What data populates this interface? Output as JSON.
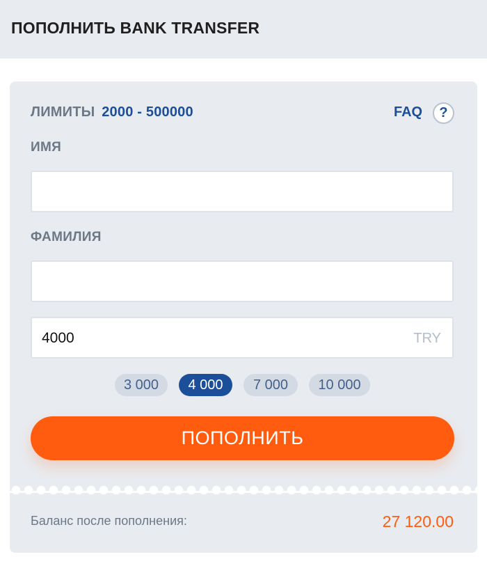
{
  "header": {
    "title": "ПОПОЛНИТЬ BANK TRANSFER"
  },
  "limits": {
    "label": "ЛИМИТЫ",
    "value": "2000 - 500000"
  },
  "faq": {
    "label": "FAQ",
    "help_glyph": "?"
  },
  "form": {
    "first_name": {
      "label": "ИМЯ",
      "value": ""
    },
    "last_name": {
      "label": "ФАМИЛИЯ",
      "value": ""
    },
    "amount": {
      "value": "4000",
      "currency": "TRY"
    }
  },
  "quick_amounts": [
    {
      "label": "3 000",
      "selected": false
    },
    {
      "label": "4 000",
      "selected": true
    },
    {
      "label": "7 000",
      "selected": false
    },
    {
      "label": "10 000",
      "selected": false
    }
  ],
  "submit": {
    "label": "ПОПОЛНИТЬ"
  },
  "balance": {
    "label": "Баланс после пополнения:",
    "value": "27 120.00"
  },
  "colors": {
    "accent": "#ff5c0f",
    "primary": "#1c4f9a",
    "panel": "#e8ebef"
  },
  "icons": {
    "help": "question-circle-icon"
  }
}
